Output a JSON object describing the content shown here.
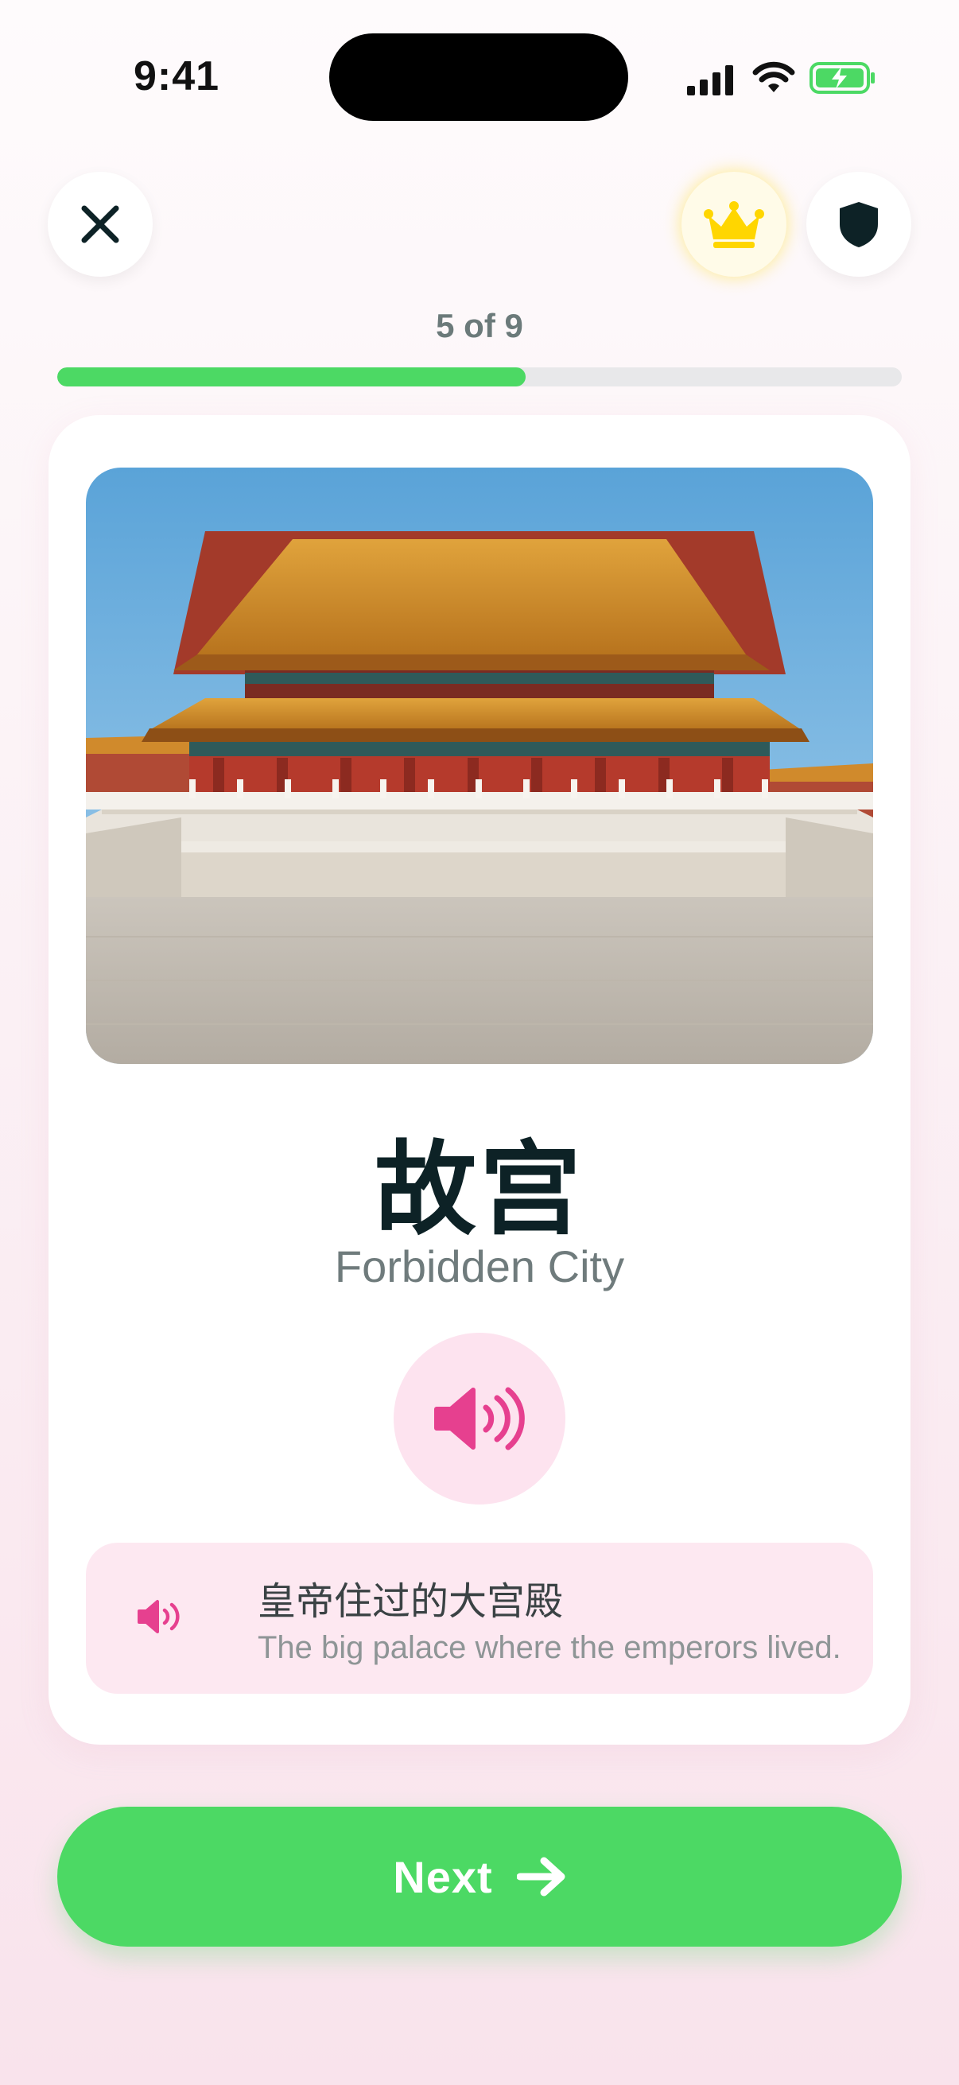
{
  "status_bar": {
    "time": "9:41",
    "icons": [
      "signal-icon",
      "wifi-icon",
      "battery-charging-icon"
    ]
  },
  "header": {
    "close_icon": "close-icon",
    "premium_icon": "crown-icon",
    "shield_icon": "shield-icon"
  },
  "progress": {
    "label": "5 of 9",
    "fraction": 0.555
  },
  "card": {
    "image_icon": "forbidden-city-photo",
    "word": "故宫",
    "translation": "Forbidden City",
    "audio_icon": "speaker-icon",
    "example": {
      "audio_icon": "speaker-icon",
      "sentence": "皇帝住过的大宫殿",
      "translation": "The big palace where the emperors lived."
    }
  },
  "footer": {
    "next_label": "Next",
    "next_icon": "arrow-right-icon"
  },
  "colors": {
    "accent_green": "#4cd964",
    "accent_pink": "#e6408f",
    "crown_yellow": "#ffd600",
    "text_dark": "#0d2226"
  }
}
